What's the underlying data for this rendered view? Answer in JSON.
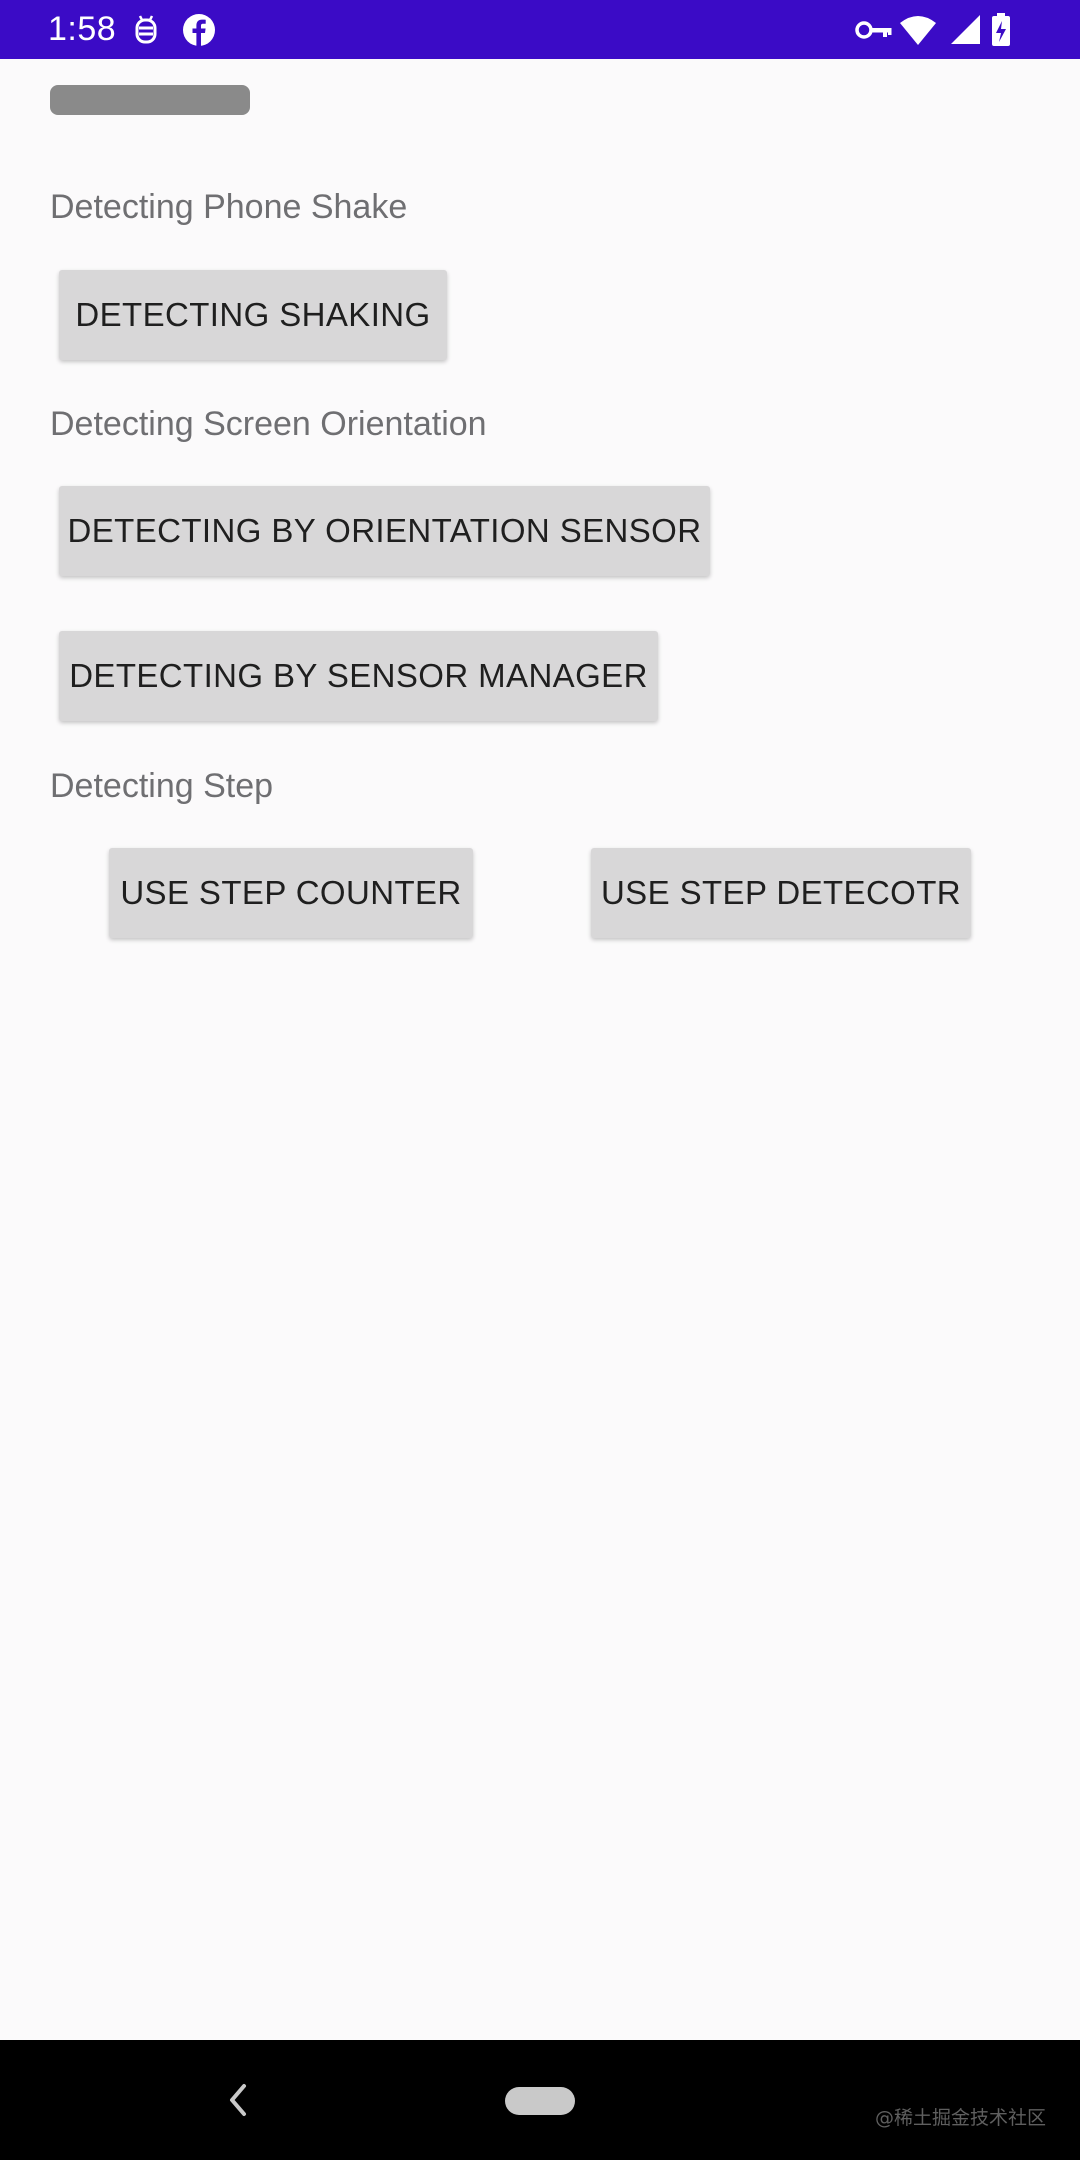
{
  "status_bar": {
    "time": "1:58",
    "background": "#3b0bc6",
    "left_icons": [
      "android-debug-icon",
      "facebook-icon"
    ],
    "right_icons": [
      "vpn-key-icon",
      "wifi-icon",
      "mobile-signal-icon",
      "battery-charging-icon"
    ]
  },
  "sections": {
    "shake": {
      "label": "Detecting Phone Shake",
      "button": "DETECTING SHAKING"
    },
    "orientation": {
      "label": "Detecting Screen Orientation",
      "button_sensor": "DETECTING BY ORIENTATION SENSOR",
      "button_manager": "DETECTING BY SENSOR MANAGER"
    },
    "step": {
      "label": "Detecting Step",
      "button_counter": "USE STEP COUNTER",
      "button_detector": "USE STEP DETECOTR"
    }
  },
  "nav_bar": {
    "icons": [
      "back-icon",
      "home-pill-icon"
    ]
  },
  "watermark": "@稀土掘金技术社区",
  "colors": {
    "accent": "#3b0bc6",
    "button_bg": "#d8d7d8",
    "label_text": "#6f6f72",
    "page_bg": "#fbfafb"
  }
}
